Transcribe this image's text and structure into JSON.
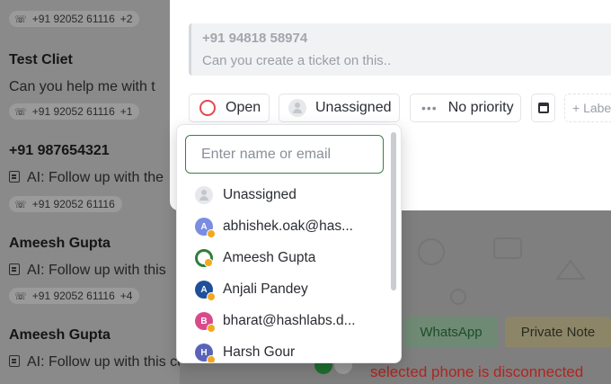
{
  "conversation_list": [
    {
      "name": "",
      "message": "",
      "phone": "+91 92052 61116",
      "extra": "+2",
      "has_ai_icon": false
    },
    {
      "name": "Test Cliet",
      "message": "Can you help me with t",
      "phone": "+91 92052 61116",
      "extra": "+1",
      "has_ai_icon": false
    },
    {
      "name": "+91 987654321",
      "message": "AI: Follow up with the",
      "phone": "+91 92052 61116",
      "extra": "",
      "has_ai_icon": true
    },
    {
      "name": "Ameesh Gupta",
      "message": "AI: Follow up with this",
      "phone": "+91 92052 61116",
      "extra": "+4",
      "has_ai_icon": true
    },
    {
      "name": "Ameesh Gupta",
      "message": "AI: Follow up with this customer to...",
      "phone": "",
      "extra": "",
      "has_ai_icon": true
    }
  ],
  "modal": {
    "quote": {
      "title": "+91 94818 58974",
      "text": "Can you create a ticket on this.."
    },
    "status": {
      "label": "Open",
      "color": "#e5484d"
    },
    "assignee": {
      "label": "Unassigned"
    },
    "priority": {
      "label": "No priority",
      "icon": "dots-icon"
    },
    "date_icon": "calendar-icon",
    "label_button": {
      "label": "+ Label"
    }
  },
  "assignee_dropdown": {
    "search": {
      "value": "",
      "placeholder": "Enter name or email"
    },
    "options": [
      {
        "label": "Unassigned",
        "avatar_type": "placeholder",
        "initial": "",
        "color": "#e7e8eb",
        "online": false
      },
      {
        "label": "abhishek.oak@has...",
        "avatar_type": "initial",
        "initial": "A",
        "color": "#7a8de0",
        "online": true
      },
      {
        "label": "Ameesh Gupta",
        "avatar_type": "photo",
        "initial": "",
        "color": "#2f7d3a",
        "online": true
      },
      {
        "label": "Anjali Pandey",
        "avatar_type": "initial",
        "initial": "A",
        "color": "#1e4f9a",
        "online": true
      },
      {
        "label": "bharat@hashlabs.d...",
        "avatar_type": "initial",
        "initial": "B",
        "color": "#d94a8c",
        "online": true
      },
      {
        "label": "Harsh Gour",
        "avatar_type": "initial",
        "initial": "H",
        "color": "#5a63b8",
        "online": true
      }
    ]
  },
  "composer": {
    "tabs": [
      "WhatsApp",
      "Private Note"
    ],
    "error_text": "selected phone is disconnected"
  }
}
